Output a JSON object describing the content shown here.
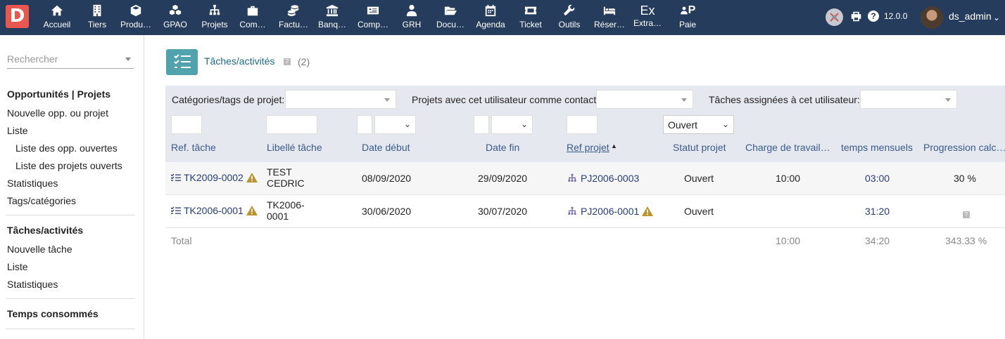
{
  "topbar": {
    "logo_letter": "D",
    "menu": [
      {
        "label": "Accueil",
        "icon": "home-icon"
      },
      {
        "label": "Tiers",
        "icon": "building-icon"
      },
      {
        "label": "Produ…",
        "icon": "cube-icon"
      },
      {
        "label": "GPAO",
        "icon": "cubes-icon"
      },
      {
        "label": "Projets",
        "icon": "sitemap-icon"
      },
      {
        "label": "Com…",
        "icon": "suitcase-icon"
      },
      {
        "label": "Factu…",
        "icon": "coins-icon"
      },
      {
        "label": "Banq…",
        "icon": "bank-icon"
      },
      {
        "label": "Comp…",
        "icon": "money-check-icon"
      },
      {
        "label": "GRH",
        "icon": "user-tie-icon"
      },
      {
        "label": "Docu…",
        "icon": "folder-open-icon"
      },
      {
        "label": "Agenda",
        "icon": "calendar-icon"
      },
      {
        "label": "Ticket",
        "icon": "ticket-icon"
      },
      {
        "label": "Outils",
        "icon": "wrench-icon"
      },
      {
        "label": "Réser…",
        "icon": "bed-icon"
      },
      {
        "label": "Extra…",
        "icon": "ex-icon"
      },
      {
        "label": "Paie",
        "icon": "user-p-icon"
      }
    ],
    "ex_glyph": "Ex",
    "paie_glyph": "P",
    "help_glyph": "?",
    "version": "12.0.0",
    "username": "ds_admin",
    "caret": "⌄",
    "accent": "#263c5c"
  },
  "sidebar": {
    "search_placeholder": "Rechercher",
    "section1_title": "Opportunités | Projets",
    "new_opp": "Nouvelle opp. ou projet",
    "list1": "Liste",
    "open_opps": "Liste des opp. ouvertes",
    "open_projects": "Liste des projets ouverts",
    "stats1": "Statistiques",
    "tags": "Tags/catégories",
    "section2_title": "Tâches/activités",
    "new_task": "Nouvelle tâche",
    "list2": "Liste",
    "stats2": "Statistiques",
    "section3_title": "Temps consommés"
  },
  "page": {
    "title": "Tâches/activités",
    "help": "?",
    "count": "(2)",
    "title_color": "#1d6b87",
    "icon_color": "#50a2ad"
  },
  "filters": {
    "cat_label": "Catégories/tags de projet:",
    "contact_label": "Projets avec cet utilisateur comme contact",
    "assigned_label": "Tâches assignées à cet utilisateur:",
    "status_value": "Ouvert",
    "chevron": "⌄"
  },
  "columns": {
    "ref": "Ref. tâche",
    "label": "Libellé tâche",
    "start": "Date début",
    "end": "Date fin",
    "project": "Ref projet",
    "sort_arrow": "▲",
    "status": "Statut projet",
    "workload": "Charge de travail…",
    "monthly": "temps mensuels",
    "progress": "Progression calc…"
  },
  "rows": [
    {
      "ref": "TK2009-0002",
      "label_line1": "TEST",
      "label_line2": "CEDRIC",
      "start": "08/09/2020",
      "end": "29/09/2020",
      "project": "PJ2006-0003",
      "project_warning": false,
      "status": "Ouvert",
      "workload": "10:00",
      "monthly": "03:00",
      "progress": "30 %"
    },
    {
      "ref": "TK2006-0001",
      "label_line1": "TK2006-",
      "label_line2": "0001",
      "start": "30/06/2020",
      "end": "30/07/2020",
      "project": "PJ2006-0001",
      "project_warning": true,
      "status": "Ouvert",
      "workload": "",
      "monthly": "31:20",
      "progress": "?"
    }
  ],
  "total": {
    "label": "Total",
    "workload": "10:00",
    "monthly": "34:20",
    "progress": "343.33 %"
  }
}
